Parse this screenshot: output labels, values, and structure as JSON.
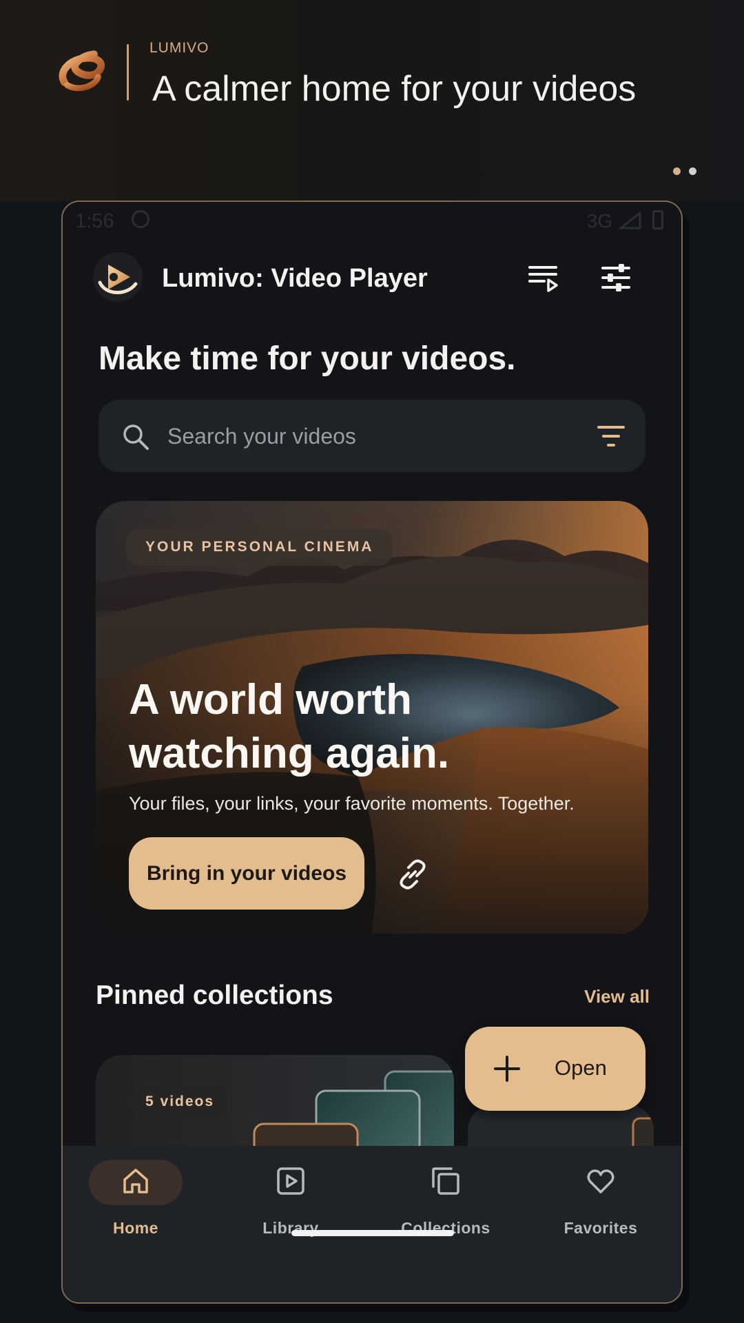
{
  "promo": {
    "brand": "LUMIVO",
    "tagline": "A calmer home for your videos",
    "page_count": 2,
    "active_page": 1
  },
  "status_bar": {
    "time": "1:56",
    "network": "3G"
  },
  "app_bar": {
    "title": "Lumivo: Video Player",
    "actions": [
      "playlist-play-icon",
      "tune-sliders-icon"
    ]
  },
  "headline": "Make time for your videos.",
  "search": {
    "placeholder": "Search your videos",
    "value": ""
  },
  "hero": {
    "eyebrow": "YOUR PERSONAL CINEMA",
    "title": "A world worth watching again.",
    "subtitle": "Your files, your links, your favorite moments. Together.",
    "cta_label": "Bring in your videos"
  },
  "pinned": {
    "title": "Pinned collections",
    "view_all": "View all",
    "collections": [
      {
        "badge": "5 videos"
      }
    ]
  },
  "fab": {
    "label": "Open"
  },
  "bottom_nav": {
    "items": [
      {
        "label": "Home",
        "icon": "home-icon",
        "active": true
      },
      {
        "label": "Library",
        "icon": "play-square-icon",
        "active": false
      },
      {
        "label": "Collections",
        "icon": "stacked-squares-icon",
        "active": false
      },
      {
        "label": "Favorites",
        "icon": "heart-icon",
        "active": false
      }
    ]
  },
  "colors": {
    "accent": "#e4bd8f",
    "background": "#121417",
    "surface": "#1f2227"
  }
}
